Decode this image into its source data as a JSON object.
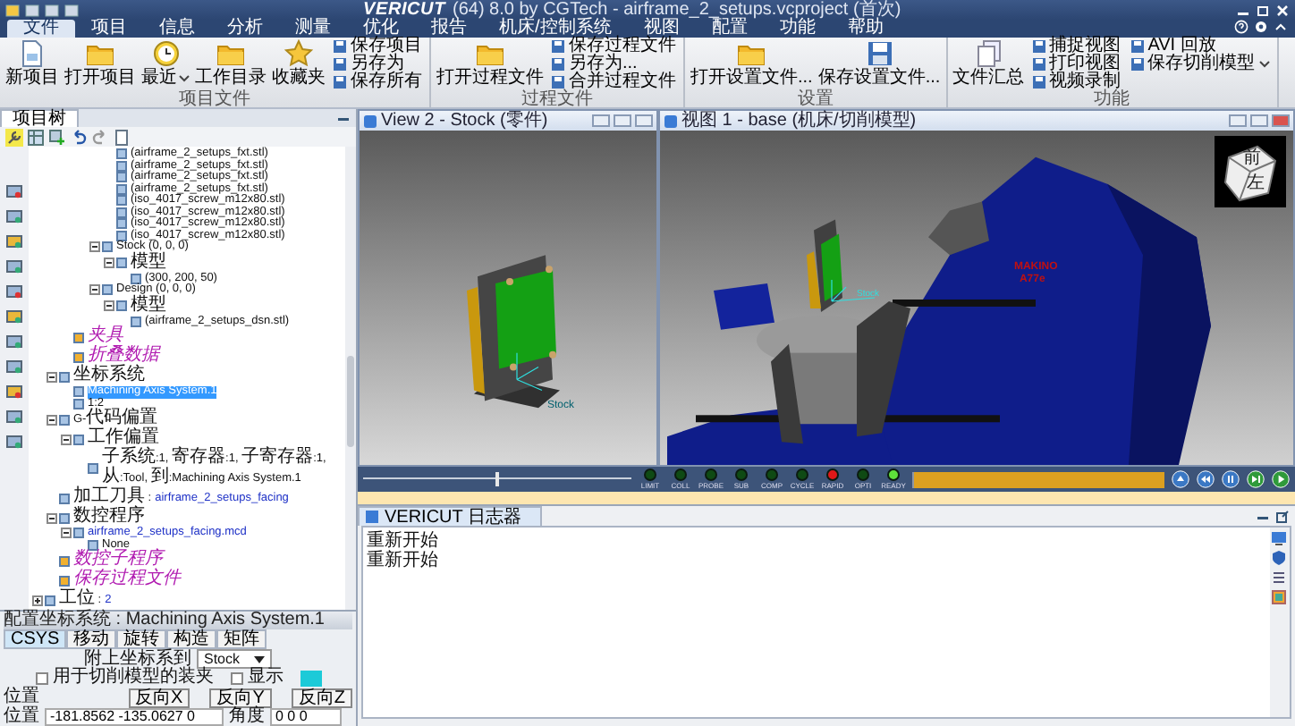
{
  "window": {
    "logo": "VERICUT",
    "title": "(64) 8.0 by CGTech - airframe_2_setups.vcproject (首次)"
  },
  "menu": [
    {
      "label": "文件",
      "selected": true
    },
    {
      "label": "项目",
      "selected": false
    },
    {
      "label": "信息",
      "selected": false
    },
    {
      "label": "分析",
      "selected": false
    },
    {
      "label": "测量",
      "selected": false
    },
    {
      "label": "优化",
      "selected": false
    },
    {
      "label": "报告",
      "selected": false
    },
    {
      "label": "机床/控制系统",
      "selected": false
    },
    {
      "label": "视图",
      "selected": false
    },
    {
      "label": "配置",
      "selected": false
    },
    {
      "label": "功能",
      "selected": false
    },
    {
      "label": "帮助",
      "selected": false
    }
  ],
  "ribbon": [
    {
      "label": "项目文件",
      "large": [
        {
          "label": "新项目"
        },
        {
          "label": "打开项目"
        },
        {
          "label": "最近",
          "dropdown": true
        },
        {
          "label": "工作目录"
        },
        {
          "label": "收藏夹"
        }
      ],
      "small_columns": [
        [
          {
            "label": "保存项目"
          },
          {
            "label": "另存为"
          },
          {
            "label": "保存所有"
          }
        ]
      ]
    },
    {
      "label": "过程文件",
      "large": [
        {
          "label": "打开过程文件"
        }
      ],
      "small_columns": [
        [
          {
            "label": "保存过程文件"
          },
          {
            "label": "另存为..."
          },
          {
            "label": "合并过程文件"
          }
        ]
      ]
    },
    {
      "label": "设置",
      "large": [
        {
          "label": "打开设置文件..."
        },
        {
          "label": "保存设置文件..."
        }
      ]
    },
    {
      "label": "功能",
      "large": [
        {
          "label": "文件汇总"
        }
      ],
      "small_columns": [
        [
          {
            "label": "捕捉视图"
          },
          {
            "label": "打印视图"
          },
          {
            "label": "视频录制"
          }
        ],
        [
          {
            "label": "AVI 回放"
          },
          {
            "label": "保存切削模型",
            "dropdown": true
          }
        ]
      ]
    }
  ],
  "left_panel": {
    "tab": "项目树",
    "tree": [
      {
        "children": [
          {
            "children": [
              {
                "children": [
                  {
                    "children": [
                      {
                        "children": [
                          {
                            "label": "(airframe_2_setups_fxt.stl)",
                            "selected": false
                          },
                          {
                            "label": "(airframe_2_setups_fxt.stl)",
                            "selected": false
                          },
                          {
                            "label": "(airframe_2_setups_fxt.stl)",
                            "selected": false
                          },
                          {
                            "label": "(airframe_2_setups_fxt.stl)",
                            "selected": false
                          },
                          {
                            "label": "(iso_4017_screw_m12x80.stl)",
                            "selected": false
                          },
                          {
                            "label": "(iso_4017_screw_m12x80.stl)",
                            "selected": false
                          },
                          {
                            "label": "(iso_4017_screw_m12x80.stl)",
                            "selected": false
                          },
                          {
                            "label": "(iso_4017_screw_m12x80.stl)",
                            "selected": false
                          }
                        ]
                      },
                      {
                        "label": "Stock (0, 0, 0)",
                        "selected": false,
                        "expanded": true,
                        "children": [
                          {
                            "label": "模型",
                            "selected": false,
                            "expanded": true,
                            "children": [
                              {
                                "label": "(300, 200, 50)",
                                "selected": false
                              }
                            ]
                          }
                        ]
                      },
                      {
                        "label": "Design (0, 0, 0)",
                        "selected": false,
                        "expanded": true,
                        "children": [
                          {
                            "label": "模型",
                            "selected": false,
                            "expanded": true,
                            "children": [
                              {
                                "label": "(airframe_2_setups_dsn.stl)",
                                "selected": false
                              }
                            ]
                          }
                        ]
                      }
                    ]
                  }
                ]
              },
              {
                "label": "夹具",
                "emphasis": true,
                "selected": false
              },
              {
                "label": "折叠数据",
                "emphasis": true,
                "selected": false
              }
            ]
          },
          {
            "label": "坐标系统",
            "selected": false,
            "expanded": true,
            "children": [
              {
                "label": "Machining Axis System.1",
                "selected": true
              },
              {
                "label": "1:2",
                "selected": false
              }
            ]
          },
          {
            "label": "G-代码偏置",
            "selected": false,
            "expanded": true,
            "children": [
              {
                "label": "工作偏置",
                "selected": false,
                "expanded": true,
                "children": [
                  {
                    "label": "子系统:1, 寄存器:1, 子寄存器:1, 从:Tool, 到:Machining Axis System.1",
                    "selected": false
                  }
                ]
              }
            ]
          },
          {
            "label": "加工刀具 :",
            "value": "airframe_2_setups_facing",
            "selected": false
          },
          {
            "label": "数控程序",
            "selected": false,
            "expanded": true,
            "children": [
              {
                "label": "airframe_2_setups_facing.mcd",
                "link": true,
                "selected": false,
                "expanded": true,
                "children": [
                  {
                    "label": "None",
                    "selected": false
                  }
                ]
              }
            ]
          },
          {
            "label": "数控子程序",
            "emphasis": true,
            "selected": false
          },
          {
            "label": "保存过程文件",
            "emphasis": true,
            "selected": false
          }
        ]
      },
      {
        "label": "工位 :",
        "value": "2",
        "selected": false,
        "expanded": false
      }
    ],
    "properties": {
      "title": "配置坐标系统 : Machining Axis System.1",
      "tabs": [
        {
          "label": "CSYS",
          "selected": true
        },
        {
          "label": "移动",
          "selected": false
        },
        {
          "label": "旋转",
          "selected": false
        },
        {
          "label": "构造",
          "selected": false
        },
        {
          "label": "矩阵",
          "selected": false
        }
      ],
      "attach_label": "附上坐标系到",
      "attach_value": "Stock",
      "checkboxes": [
        {
          "label": "用于切削模型的装夹",
          "checked": false
        },
        {
          "label": "显示",
          "checked": false,
          "color": "#1ccad8"
        }
      ],
      "section_label": "位置",
      "fields": [
        {
          "label": "位置",
          "value": "-181.8562 -135.0627 0"
        },
        {
          "label": "角度",
          "value": "0 0 0"
        }
      ],
      "buttons": [
        "反向X",
        "反向Y",
        "反向Z"
      ]
    }
  },
  "views": [
    {
      "title": "View 2 - Stock (零件)",
      "kind": "stock",
      "labels": [
        "Stock"
      ]
    },
    {
      "title": "视图 1 - base (机床/切削模型)",
      "kind": "machine",
      "labels": [
        "Stock",
        "MAKINO",
        "A77e"
      ],
      "cube_faces": [
        "前",
        "左"
      ]
    }
  ],
  "sim_bar": {
    "slider": {
      "level": 0.5
    },
    "lights": [
      {
        "label": "LIMIT",
        "color": "#0f4a14"
      },
      {
        "label": "COLL",
        "color": "#0f4a14"
      },
      {
        "label": "PROBE",
        "color": "#0f4a14"
      },
      {
        "label": "SUB",
        "color": "#0f4a14"
      },
      {
        "label": "COMP",
        "color": "#0f4a14"
      },
      {
        "label": "CYCLE",
        "color": "#0f4a14"
      },
      {
        "label": "RAPID",
        "color": "#e01818"
      },
      {
        "label": "OPTI",
        "color": "#0f4a14"
      },
      {
        "label": "READY",
        "color": "#5ee03a"
      }
    ],
    "progress": {
      "level": 0.99
    }
  },
  "log": {
    "tab": "VERICUT 日志器",
    "lines": [
      "重新开始",
      "重新开始"
    ]
  }
}
